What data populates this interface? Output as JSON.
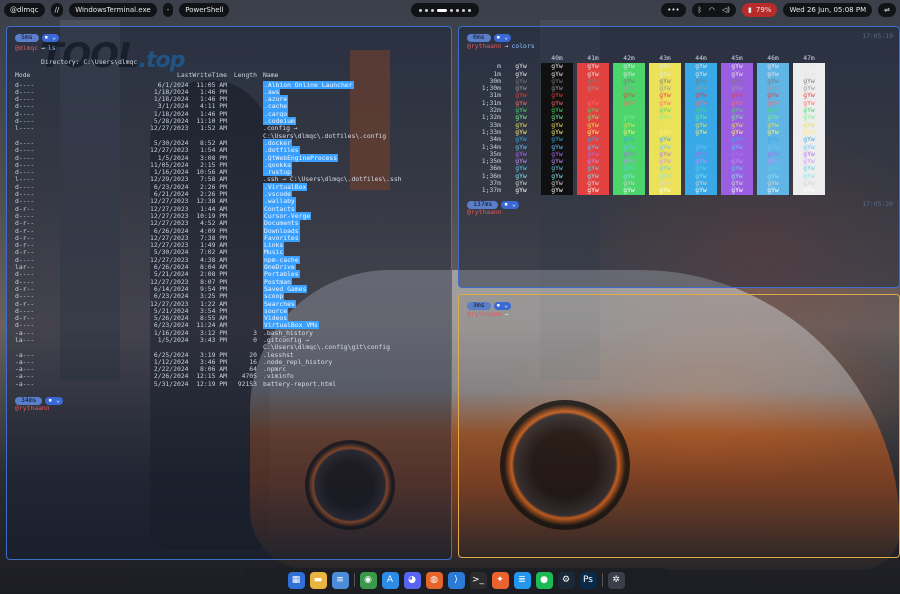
{
  "topbar": {
    "user": "@dlmqc",
    "separator1": "//",
    "app": "WindowsTerminal.exe",
    "separator2": "-",
    "title": "PowerShell",
    "tray_more": "•••",
    "battery": "79%",
    "datetime": "Wed 26 Jun, 05:08 PM"
  },
  "watermark": {
    "main": "TOOL",
    "suffix": ".top"
  },
  "left_pane": {
    "prompt_time": "5ms",
    "user": "@dlmqc",
    "arrow": "→",
    "command": "ls",
    "directory_line": "Directory: C:\\Users\\dlmqc",
    "headers": {
      "mode": "Mode",
      "time": "LastWriteTime",
      "length": "Length",
      "name": "Name"
    },
    "rows": [
      {
        "mode": "d----",
        "time": "6/1/2024  11:05 AM",
        "len": "",
        "name": ".Albion Online Launcher",
        "kind": "dir"
      },
      {
        "mode": "d----",
        "time": "1/18/2024   1:46 PM",
        "len": "",
        "name": ".aws",
        "kind": "dir"
      },
      {
        "mode": "d----",
        "time": "1/18/2024   1:46 PM",
        "len": "",
        "name": ".azure",
        "kind": "dir"
      },
      {
        "mode": "d----",
        "time": "3/1/2024   4:11 PM",
        "len": "",
        "name": ".cache",
        "kind": "dir"
      },
      {
        "mode": "d----",
        "time": "1/18/2024   1:46 PM",
        "len": "",
        "name": ".cargo",
        "kind": "dir"
      },
      {
        "mode": "d----",
        "time": "5/28/2024  11:10 PM",
        "len": "",
        "name": ".codeium",
        "kind": "dir"
      },
      {
        "mode": "l----",
        "time": "12/27/2023   1:52 AM",
        "len": "",
        "name": ".config → ",
        "kind": "link"
      },
      {
        "mode": "",
        "time": "",
        "len": "",
        "name": "C:\\Users\\dlmqc\\.dotfiles\\.config",
        "kind": "file"
      },
      {
        "mode": "d----",
        "time": "5/30/2024   8:52 AM",
        "len": "",
        "name": ".docker",
        "kind": "dir"
      },
      {
        "mode": "d----",
        "time": "12/27/2023   1:54 AM",
        "len": "",
        "name": ".dotfiles",
        "kind": "dir"
      },
      {
        "mode": "d----",
        "time": "1/5/2024   3:08 PM",
        "len": "",
        "name": ".QtWebEngineProcess",
        "kind": "dir"
      },
      {
        "mode": "d----",
        "time": "11/05/2024   2:15 PM",
        "len": "",
        "name": ".qookka",
        "kind": "dir"
      },
      {
        "mode": "d----",
        "time": "1/16/2024  10:56 AM",
        "len": "",
        "name": ".rustup",
        "kind": "dir"
      },
      {
        "mode": "l----",
        "time": "12/29/2023   7:58 AM",
        "len": "",
        "name": ".ssh → C:\\Users\\dlmqc\\.dotfiles\\.ssh",
        "kind": "link"
      },
      {
        "mode": "d----",
        "time": "6/23/2024   2:26 PM",
        "len": "",
        "name": ".VirtualBox",
        "kind": "dir"
      },
      {
        "mode": "d----",
        "time": "6/21/2024   2:26 PM",
        "len": "",
        "name": ".vscode",
        "kind": "dir"
      },
      {
        "mode": "d----",
        "time": "12/27/2023  12:38 AM",
        "len": "",
        "name": ".wallaby",
        "kind": "dir"
      },
      {
        "mode": "d-r--",
        "time": "12/27/2023   1:44 AM",
        "len": "",
        "name": "Contacts",
        "kind": "dir"
      },
      {
        "mode": "d----",
        "time": "12/27/2023  10:19 PM",
        "len": "",
        "name": "Cursor-Verge",
        "kind": "dir"
      },
      {
        "mode": "d-r--",
        "time": "12/27/2023   4:52 AM",
        "len": "",
        "name": "Documents",
        "kind": "dir"
      },
      {
        "mode": "d-r--",
        "time": "6/26/2024   4:09 PM",
        "len": "",
        "name": "Downloads",
        "kind": "dir"
      },
      {
        "mode": "d-r--",
        "time": "12/27/2023   7:38 PM",
        "len": "",
        "name": "Favorites",
        "kind": "dir"
      },
      {
        "mode": "d-r--",
        "time": "12/27/2023   1:49 AM",
        "len": "",
        "name": "Links",
        "kind": "dir"
      },
      {
        "mode": "d-r--",
        "time": "5/30/2024   7:02 AM",
        "len": "",
        "name": "Music",
        "kind": "dir"
      },
      {
        "mode": "d----",
        "time": "12/27/2023   4:38 AM",
        "len": "",
        "name": "npm-cache",
        "kind": "dir"
      },
      {
        "mode": "lar--",
        "time": "6/26/2024   8:04 AM",
        "len": "",
        "name": "OneDrive",
        "kind": "dir"
      },
      {
        "mode": "d----",
        "time": "5/21/2024   2:08 PM",
        "len": "",
        "name": "Portables",
        "kind": "dir"
      },
      {
        "mode": "d----",
        "time": "12/27/2023   8:07 PM",
        "len": "",
        "name": "Postman",
        "kind": "dir"
      },
      {
        "mode": "d-r--",
        "time": "6/14/2024   9:54 PM",
        "len": "",
        "name": "Saved Games",
        "kind": "dir"
      },
      {
        "mode": "d----",
        "time": "6/23/2024   3:25 PM",
        "len": "",
        "name": "scoop",
        "kind": "dir"
      },
      {
        "mode": "d-r--",
        "time": "12/27/2023   1:22 AM",
        "len": "",
        "name": "Searches",
        "kind": "dir"
      },
      {
        "mode": "d----",
        "time": "5/21/2024   3:54 PM",
        "len": "",
        "name": "source",
        "kind": "dir"
      },
      {
        "mode": "d-r--",
        "time": "5/26/2024   8:55 AM",
        "len": "",
        "name": "Videos",
        "kind": "dir"
      },
      {
        "mode": "d----",
        "time": "6/23/2024  11:24 AM",
        "len": "",
        "name": "VirtualBox VMs",
        "kind": "dir"
      },
      {
        "mode": "-a---",
        "time": "1/16/2024   3:12 PM",
        "len": "3",
        "name": ".bash_history",
        "kind": "file"
      },
      {
        "mode": "la---",
        "time": "1/5/2024   3:43 PM",
        "len": "0",
        "name": ".gitconfig → ",
        "kind": "file"
      },
      {
        "mode": "",
        "time": "",
        "len": "",
        "name": "C:\\Users\\dlmqc\\.config\\git\\config",
        "kind": "file"
      },
      {
        "mode": "-a---",
        "time": "6/25/2024   3:19 PM",
        "len": "20",
        "name": ".lesshst",
        "kind": "file"
      },
      {
        "mode": "-a---",
        "time": "1/12/2024   3:46 PM",
        "len": "16",
        "name": ".node_repl_history",
        "kind": "file"
      },
      {
        "mode": "-a---",
        "time": "2/22/2024   8:06 AM",
        "len": "64",
        "name": ".npmrc",
        "kind": "file"
      },
      {
        "mode": "-a---",
        "time": "2/26/2024  12:15 AM",
        "len": "4705",
        "name": ".viminfo",
        "kind": "file"
      },
      {
        "mode": "-a---",
        "time": "5/31/2024  12:19 PM",
        "len": "92153",
        "name": "battery-report.html",
        "kind": "file"
      }
    ],
    "footer_time": "34ms",
    "footer_user": "@rythaann"
  },
  "right_top_pane": {
    "prompt_time": "0ms",
    "user": "@rythaann",
    "arrow": "→",
    "command": "colors",
    "timestamp": "17:05:19",
    "col_headers": [
      "40m",
      "41m",
      "42m",
      "43m",
      "44m",
      "45m",
      "46m",
      "47m"
    ],
    "row_labels": [
      "m",
      "1m",
      "30m",
      "1;30m",
      "31m",
      "1;31m",
      "32m",
      "1;32m",
      "33m",
      "1;33m",
      "34m",
      "1;34m",
      "35m",
      "1;35m",
      "36m",
      "1;36m",
      "37m",
      "1;37m"
    ],
    "sample": "gYw",
    "bg_colors": [
      "#101010",
      "#e2413f",
      "#4bd56a",
      "#ebe25a",
      "#38a8e6",
      "#9a5fe0",
      "#5fb6e6",
      "#ededed"
    ],
    "fg_colors": [
      "#e6e6e6",
      "#e6e6e6",
      "#7a7a7a",
      "#9a9a9a",
      "#e2413f",
      "#ff6b6b",
      "#4bd56a",
      "#7cf08f",
      "#ebe25a",
      "#fff27a",
      "#38a8e6",
      "#6cc4ff",
      "#b06ef0",
      "#c792ff",
      "#5fd0e6",
      "#8ae3f2",
      "#d6d6d6",
      "#ffffff"
    ],
    "footer_time": "137ms",
    "footer_user": "@rythaann",
    "footer_timestamp": "17:05:20"
  },
  "right_bottom_pane": {
    "prompt_time": "3ms",
    "user": "@rythaann",
    "arrow": "→"
  },
  "dock": {
    "apps": [
      {
        "name": "file-explorer-icon",
        "glyph": "▦",
        "color": "#2f6fd6"
      },
      {
        "name": "folder-icon",
        "glyph": "▬",
        "color": "#e8b540"
      },
      {
        "name": "notes-icon",
        "glyph": "≡",
        "color": "#4c8cd8"
      },
      {
        "name": "chrome-icon",
        "glyph": "◉",
        "color": "#3b9a4a"
      },
      {
        "name": "app-store-icon",
        "glyph": "A",
        "color": "#2b8de6"
      },
      {
        "name": "discord-icon",
        "glyph": "◕",
        "color": "#5865f2"
      },
      {
        "name": "firefox-icon",
        "glyph": "◍",
        "color": "#e5642b"
      },
      {
        "name": "vscode-icon",
        "glyph": "⟩",
        "color": "#2a7ad6"
      },
      {
        "name": "terminal-icon",
        "glyph": ">_",
        "color": "#2b2b2b"
      },
      {
        "name": "postman-icon",
        "glyph": "✦",
        "color": "#e9622f"
      },
      {
        "name": "docker-icon",
        "glyph": "≣",
        "color": "#2496ed"
      },
      {
        "name": "spotify-icon",
        "glyph": "●",
        "color": "#1db954"
      },
      {
        "name": "steam-icon",
        "glyph": "⚙",
        "color": "#1b2838"
      },
      {
        "name": "photoshop-icon",
        "glyph": "Ps",
        "color": "#0a2a4a"
      },
      {
        "name": "settings-icon",
        "glyph": "✲",
        "color": "#3a3f4a"
      }
    ]
  }
}
